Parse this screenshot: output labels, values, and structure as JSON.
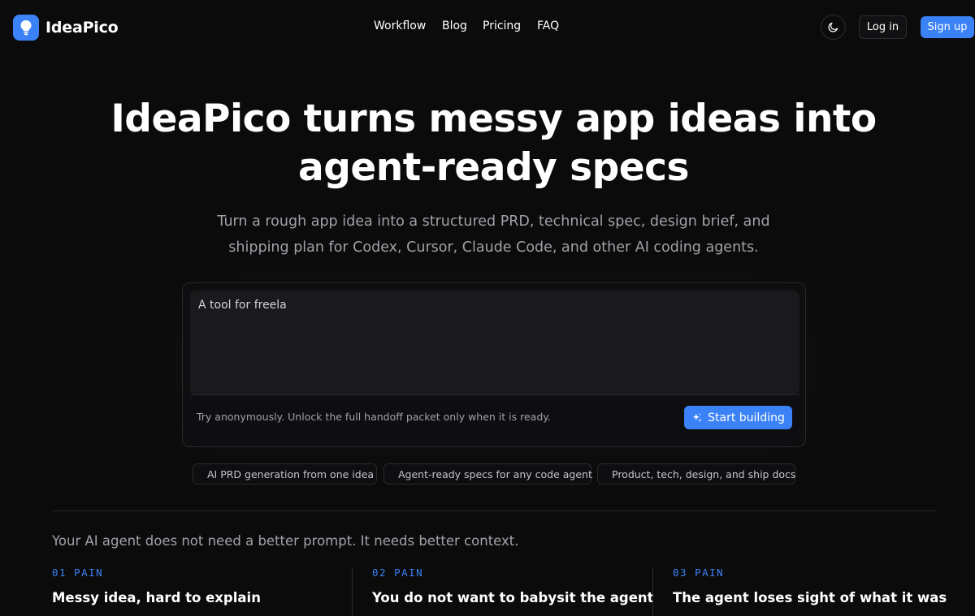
{
  "brand": {
    "name": "IdeaPico",
    "accent_color": "#3b82f6",
    "logo_icon": "lightbulb-icon"
  },
  "nav": {
    "items": [
      {
        "label": "Workflow"
      },
      {
        "label": "Blog"
      },
      {
        "label": "Pricing"
      },
      {
        "label": "FAQ"
      }
    ]
  },
  "header_actions": {
    "theme_icon": "moon-icon",
    "login_label": "Log in",
    "signup_label": "Sign up"
  },
  "hero": {
    "title_line1": "IdeaPico turns messy app ideas into",
    "title_line2": "agent-ready specs",
    "subtitle_line1": "Turn a rough app idea into a structured PRD, technical spec, design brief, and",
    "subtitle_line2": "shipping plan for Codex, Cursor, Claude Code, and other AI coding agents."
  },
  "idea_box": {
    "value": "A tool for freela",
    "note": "Try anonymously. Unlock the full handoff packet only when it is ready.",
    "button_label": "Start building",
    "button_icon": "sparkles-icon"
  },
  "features": [
    {
      "label": "AI PRD generation from one idea"
    },
    {
      "label": "Agent-ready specs for any code agent"
    },
    {
      "label": "Product, tech, design, and ship docs"
    }
  ],
  "context": {
    "headline": "Your AI agent does not need a better prompt. It needs better context."
  },
  "pains": [
    {
      "label": "01  PAIN",
      "title": "Messy idea, hard to explain"
    },
    {
      "label": "02  PAIN",
      "title": "You do not want to babysit the agent"
    },
    {
      "label": "03  PAIN",
      "title": "The agent loses sight of what it was"
    }
  ]
}
